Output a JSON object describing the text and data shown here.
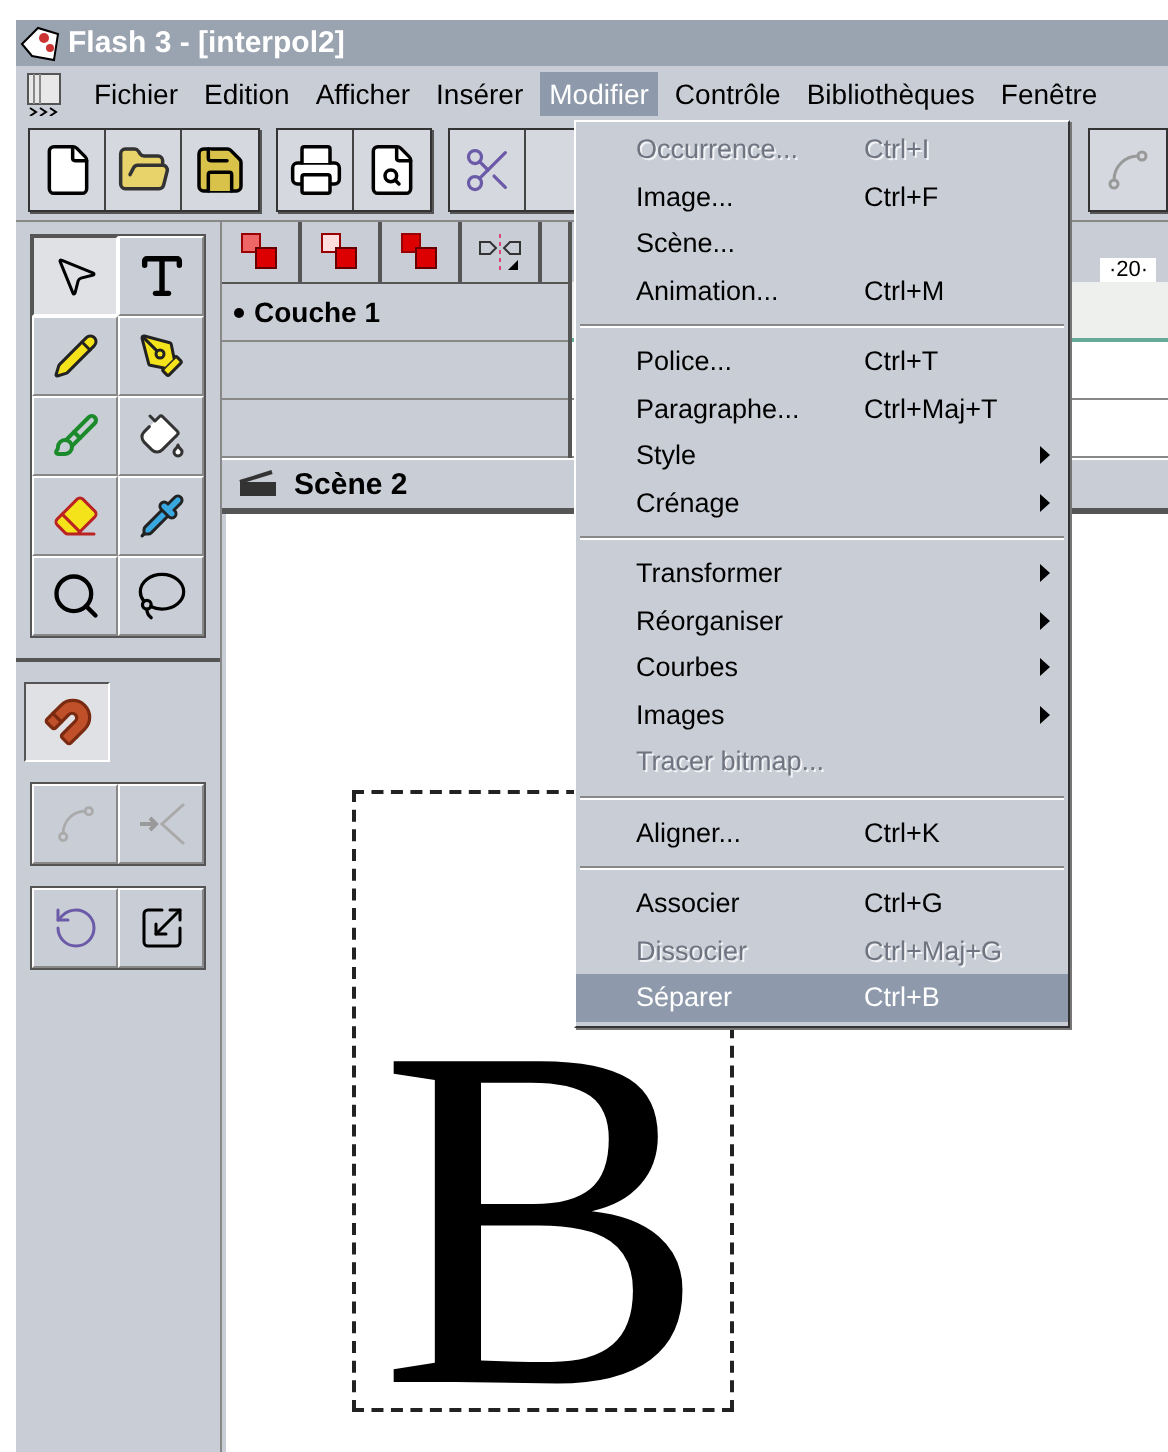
{
  "window": {
    "title": "Flash 3 - [interpol2]"
  },
  "menu_bar": [
    {
      "label": "Fichier",
      "selected": false
    },
    {
      "label": "Edition",
      "selected": false
    },
    {
      "label": "Afficher",
      "selected": false
    },
    {
      "label": "Insérer",
      "selected": false
    },
    {
      "label": "Modifier",
      "selected": true
    },
    {
      "label": "Contrôle",
      "selected": false
    },
    {
      "label": "Bibliothèques",
      "selected": false
    },
    {
      "label": "Fenêtre",
      "selected": false
    }
  ],
  "tools": [
    {
      "selected": true
    },
    {
      "selected": false
    },
    {
      "selected": false
    },
    {
      "selected": false
    },
    {
      "selected": false
    },
    {
      "selected": false
    },
    {
      "selected": false
    },
    {
      "selected": false
    },
    {
      "selected": false
    },
    {
      "selected": false
    }
  ],
  "snap": {
    "on": true
  },
  "timeline": {
    "layers": [
      {
        "name": "Couche 1"
      }
    ],
    "ruler_label": "·20·",
    "scene": "Scène 2"
  },
  "stage": {
    "text": "B"
  },
  "menu": {
    "sections": [
      [
        {
          "label": "Occurrence...",
          "shortcut": "Ctrl+I",
          "disabled": true,
          "submenu": false,
          "selected": false
        },
        {
          "label": "Image...",
          "shortcut": "Ctrl+F",
          "disabled": false,
          "submenu": false,
          "selected": false
        },
        {
          "label": "Scène...",
          "disabled": false,
          "submenu": false,
          "selected": false
        },
        {
          "label": "Animation...",
          "shortcut": "Ctrl+M",
          "disabled": false,
          "submenu": false,
          "selected": false
        }
      ],
      [
        {
          "label": "Police...",
          "shortcut": "Ctrl+T",
          "disabled": false,
          "submenu": false,
          "selected": false
        },
        {
          "label": "Paragraphe...",
          "shortcut": "Ctrl+Maj+T",
          "disabled": false,
          "submenu": false,
          "selected": false
        },
        {
          "label": "Style",
          "disabled": false,
          "submenu": true,
          "selected": false
        },
        {
          "label": "Crénage",
          "disabled": false,
          "submenu": true,
          "selected": false
        }
      ],
      [
        {
          "label": "Transformer",
          "disabled": false,
          "submenu": true,
          "selected": false
        },
        {
          "label": "Réorganiser",
          "disabled": false,
          "submenu": true,
          "selected": false
        },
        {
          "label": "Courbes",
          "disabled": false,
          "submenu": true,
          "selected": false
        },
        {
          "label": "Images",
          "disabled": false,
          "submenu": true,
          "selected": false
        },
        {
          "label": "Tracer bitmap...",
          "disabled": true,
          "submenu": false,
          "selected": false
        }
      ],
      [
        {
          "label": "Aligner...",
          "shortcut": "Ctrl+K",
          "disabled": false,
          "submenu": false,
          "selected": false
        }
      ],
      [
        {
          "label": "Associer",
          "shortcut": "Ctrl+G",
          "disabled": false,
          "submenu": false,
          "selected": false
        },
        {
          "label": "Dissocier",
          "shortcut": "Ctrl+Maj+G",
          "disabled": true,
          "submenu": false,
          "selected": false
        },
        {
          "label": "Séparer",
          "shortcut": "Ctrl+B",
          "disabled": false,
          "submenu": false,
          "selected": true
        }
      ]
    ]
  }
}
